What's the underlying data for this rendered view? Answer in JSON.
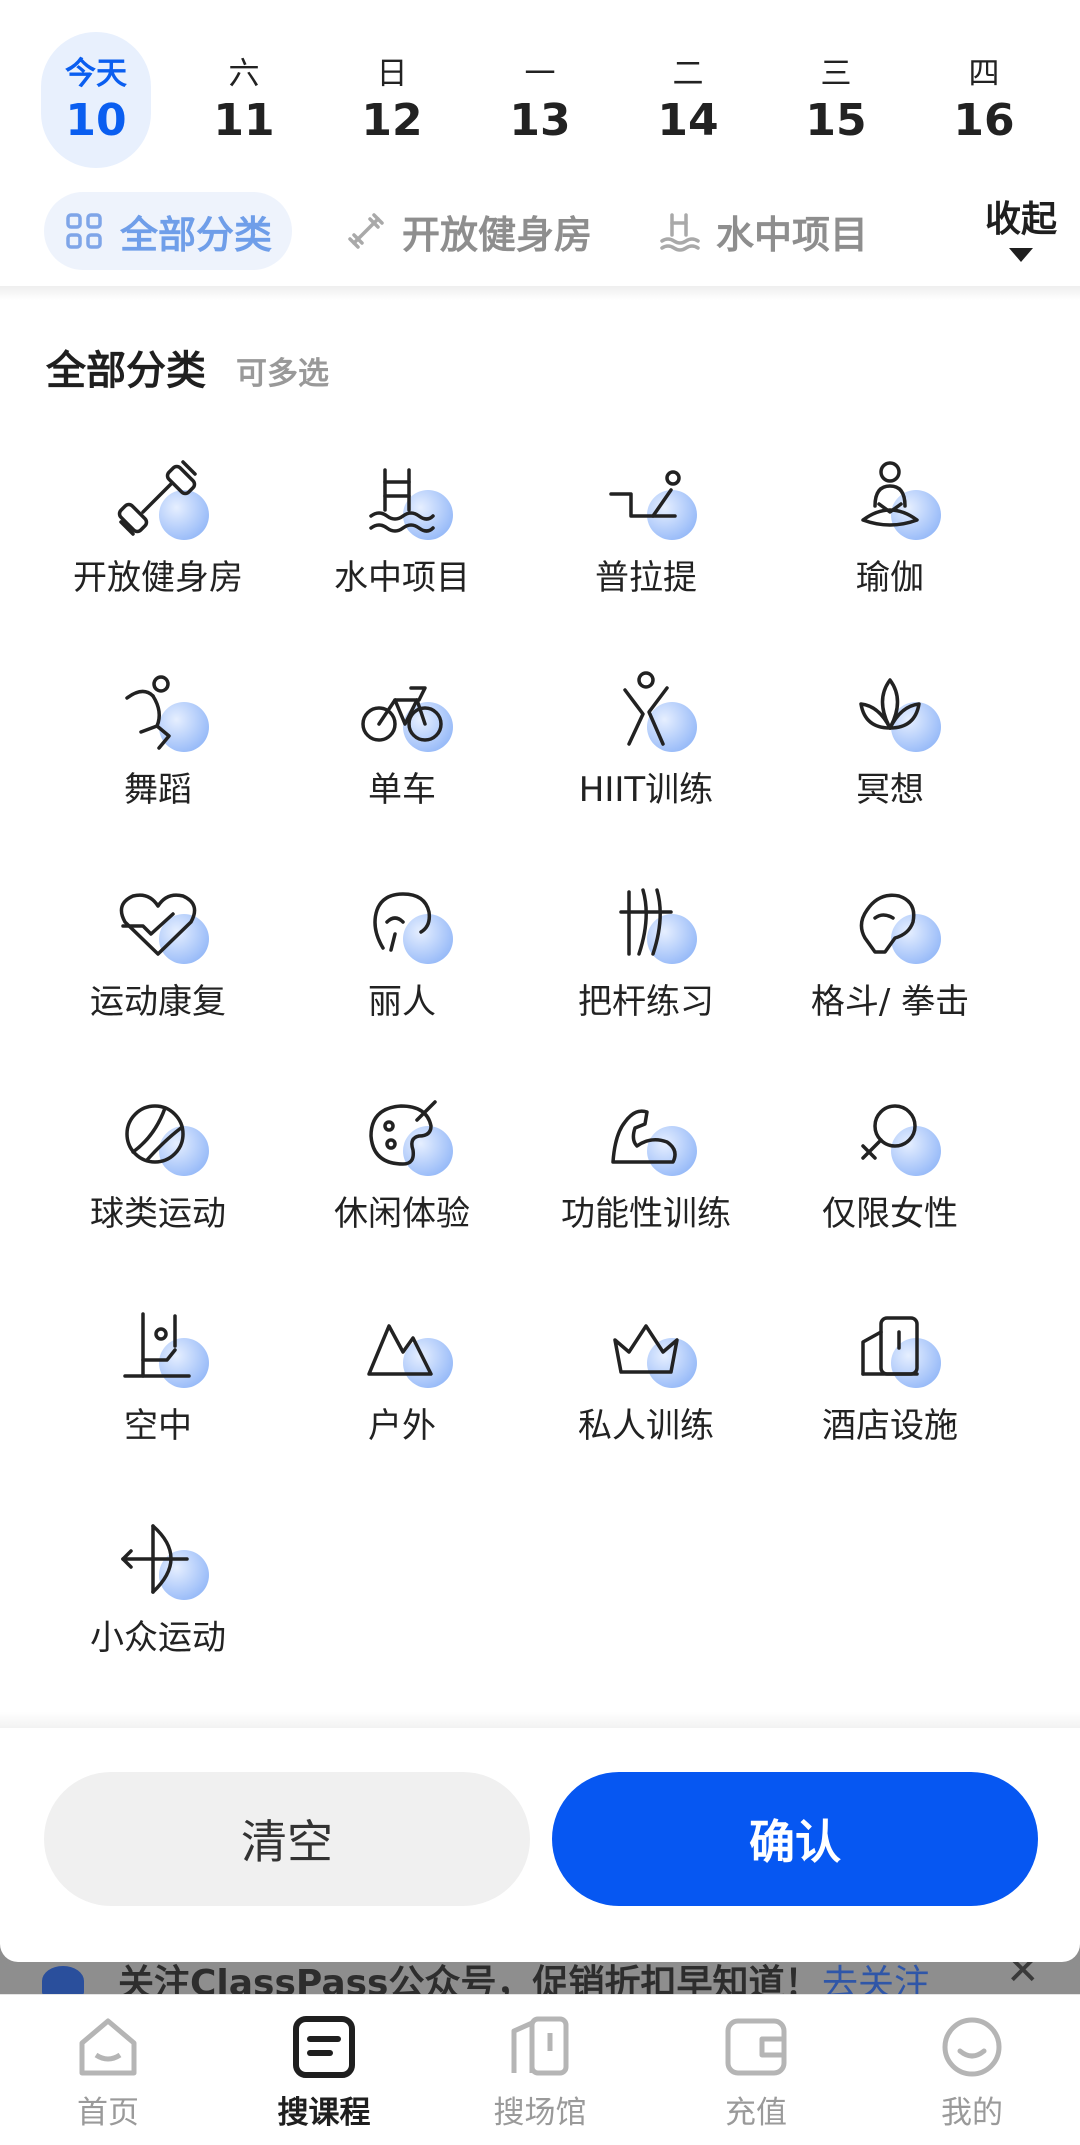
{
  "dates": [
    {
      "weekday": "今天",
      "day": "10",
      "selected": true
    },
    {
      "weekday": "六",
      "day": "11",
      "selected": false
    },
    {
      "weekday": "日",
      "day": "12",
      "selected": false
    },
    {
      "weekday": "一",
      "day": "13",
      "selected": false
    },
    {
      "weekday": "二",
      "day": "14",
      "selected": false
    },
    {
      "weekday": "三",
      "day": "15",
      "selected": false
    },
    {
      "weekday": "四",
      "day": "16",
      "selected": false
    }
  ],
  "tabs": [
    {
      "label": "全部分类",
      "icon": "grid-icon",
      "selected": true
    },
    {
      "label": "开放健身房",
      "icon": "dumbbell-icon",
      "selected": false
    },
    {
      "label": "水中项目",
      "icon": "swimming-pool-icon",
      "selected": false
    }
  ],
  "collapse_label": "收起",
  "section": {
    "title": "全部分类",
    "hint": "可多选"
  },
  "categories": [
    {
      "label": "开放健身房",
      "icon": "dumbbell-icon"
    },
    {
      "label": "水中项目",
      "icon": "pool-ladder-icon"
    },
    {
      "label": "普拉提",
      "icon": "pilates-icon"
    },
    {
      "label": "瑜伽",
      "icon": "yoga-icon"
    },
    {
      "label": "舞蹈",
      "icon": "dance-icon"
    },
    {
      "label": "单车",
      "icon": "bicycle-icon"
    },
    {
      "label": "HIIT训练",
      "icon": "hiit-icon"
    },
    {
      "label": "冥想",
      "icon": "lotus-icon"
    },
    {
      "label": "运动康复",
      "icon": "heart-check-icon"
    },
    {
      "label": "丽人",
      "icon": "beauty-icon"
    },
    {
      "label": "把杆练习",
      "icon": "barre-icon"
    },
    {
      "label": "格斗/ 拳击",
      "icon": "boxing-glove-icon"
    },
    {
      "label": "球类运动",
      "icon": "ball-icon"
    },
    {
      "label": "休闲体验",
      "icon": "palette-icon"
    },
    {
      "label": "功能性训练",
      "icon": "muscle-icon"
    },
    {
      "label": "仅限女性",
      "icon": "female-icon"
    },
    {
      "label": "空中",
      "icon": "aerial-icon"
    },
    {
      "label": "户外",
      "icon": "mountain-icon"
    },
    {
      "label": "私人训练",
      "icon": "crown-icon"
    },
    {
      "label": "酒店设施",
      "icon": "hotel-icon"
    },
    {
      "label": "小众运动",
      "icon": "archery-icon"
    }
  ],
  "buttons": {
    "clear": "清空",
    "confirm": "确认"
  },
  "banner": {
    "text": "关注ClassPass公众号，促销折扣早知道！",
    "link": "去关注",
    "close": "✕"
  },
  "nav": [
    {
      "label": "首页",
      "icon": "home-icon",
      "selected": false
    },
    {
      "label": "搜课程",
      "icon": "course-search-icon",
      "selected": true
    },
    {
      "label": "搜场馆",
      "icon": "venue-icon",
      "selected": false
    },
    {
      "label": "充值",
      "icon": "wallet-icon",
      "selected": false
    },
    {
      "label": "我的",
      "icon": "profile-icon",
      "selected": false
    }
  ],
  "colors": {
    "accent": "#0657f2",
    "selected_bg": "#e8f0fd",
    "icon_blob": "#7faaf6"
  }
}
